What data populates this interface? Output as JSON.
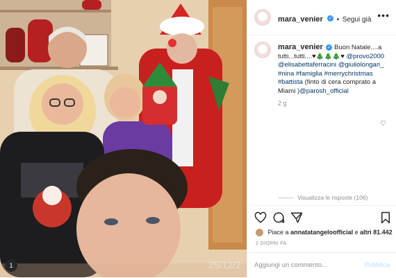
{
  "post": {
    "photo_timestamp": "25/12/2",
    "user_tag_count": "1"
  },
  "header": {
    "username": "mara_venier",
    "verified_mark": "✓",
    "separator": "•",
    "follow_status": "Segui già",
    "more": "•••"
  },
  "caption": {
    "username": "mara_venier",
    "verified_mark": "✓",
    "text_1": "Buon Natale....a tutti...tutti....",
    "emojis": "♥🎄🎄🎄♥",
    "mention_1": "@provo2000",
    "mention_2": "@elisabettaferracini",
    "mention_3": "@giuliolongari_",
    "hashtag_1": "#nina",
    "hashtag_2": "#famiglia",
    "hashtag_3": "#merrychristmas",
    "hashtag_4": "#battista",
    "text_2": "(finto di cera comprato a Miami )",
    "mention_4": "@parosh_official",
    "time": "2 g"
  },
  "replies": {
    "label": "Visualizza le risposte (106)"
  },
  "likes": {
    "prefix": "Piace a",
    "user": "annatatangeloofficial",
    "middle": "e",
    "others": "altri 81.442"
  },
  "date": "2 GIORNI FA",
  "comment": {
    "placeholder": "Aggiungi un commento...",
    "publish": "Pubblica"
  },
  "colors": {
    "accent_blue": "#3897f0",
    "link": "#00376b",
    "publish_disabled": "#b2dffc"
  }
}
